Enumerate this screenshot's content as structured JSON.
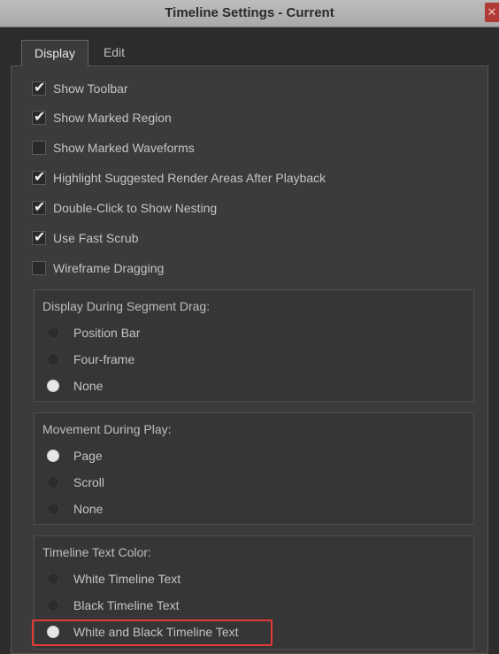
{
  "window": {
    "title": "Timeline Settings - Current",
    "close_icon": "close-icon"
  },
  "tabs": [
    {
      "label": "Display",
      "active": true
    },
    {
      "label": "Edit",
      "active": false
    }
  ],
  "checkboxes": [
    {
      "label": "Show Toolbar",
      "checked": true
    },
    {
      "label": "Show Marked Region",
      "checked": true
    },
    {
      "label": "Show Marked Waveforms",
      "checked": false
    },
    {
      "label": "Highlight Suggested Render Areas After Playback",
      "checked": true
    },
    {
      "label": "Double-Click to Show Nesting",
      "checked": true
    },
    {
      "label": "Use Fast Scrub",
      "checked": true
    },
    {
      "label": "Wireframe Dragging",
      "checked": false
    }
  ],
  "groups": {
    "segment_drag": {
      "title": "Display During Segment Drag:",
      "options": [
        {
          "label": "Position Bar",
          "selected": false
        },
        {
          "label": "Four-frame",
          "selected": false
        },
        {
          "label": "None",
          "selected": true
        }
      ]
    },
    "movement_play": {
      "title": "Movement During Play:",
      "options": [
        {
          "label": "Page",
          "selected": true
        },
        {
          "label": "Scroll",
          "selected": false
        },
        {
          "label": "None",
          "selected": false
        }
      ]
    },
    "text_color": {
      "title": "Timeline Text Color:",
      "options": [
        {
          "label": "White Timeline Text",
          "selected": false
        },
        {
          "label": "Black Timeline Text",
          "selected": false
        },
        {
          "label": "White and Black Timeline Text",
          "selected": true
        }
      ]
    }
  },
  "colors": {
    "highlight_outline": "#e23a33",
    "background": "#2f2f2f"
  }
}
